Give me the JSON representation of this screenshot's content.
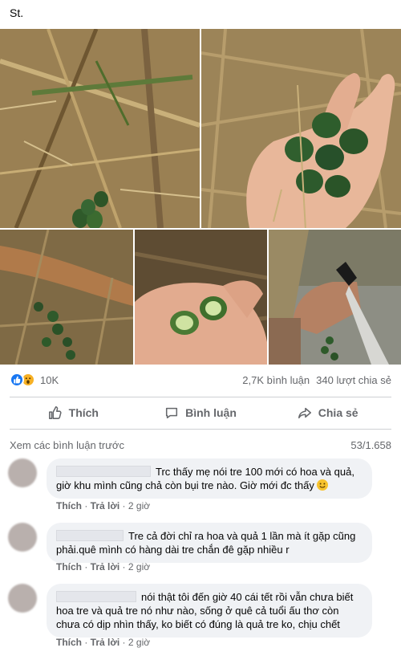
{
  "post": {
    "text": "St."
  },
  "photos": [
    {
      "icon": "bamboo-branch-photo"
    },
    {
      "icon": "hand-holding-bamboo-fruit-photo"
    },
    {
      "icon": "bamboo-stem-fruit-photo"
    },
    {
      "icon": "cut-fruit-in-hand-photo"
    },
    {
      "icon": "hand-with-knife-photo"
    }
  ],
  "stats": {
    "reaction_count": "10K",
    "comments": "2,7K bình luận",
    "shares": "340 lượt chia sẻ"
  },
  "actions": {
    "like": "Thích",
    "comment": "Bình luận",
    "share": "Chia sẻ"
  },
  "comments_header": {
    "view_previous": "Xem các bình luận trước",
    "count": "53/1.658"
  },
  "comments": [
    {
      "text": "Trc thấy mẹ nói tre 100 mới có hoa và quả, giờ khu mình cũng chả còn bụi tre nào. Giờ mới đc thấy",
      "like": "Thích",
      "reply": "Trả lời",
      "time": "2 giờ"
    },
    {
      "text": "Tre cả đời chỉ ra hoa và quả 1 lần mà ít gặp cũng phải.quê mình có hàng dài tre chắn đê gặp nhiều r",
      "like": "Thích",
      "reply": "Trả lời",
      "time": "2 giờ"
    },
    {
      "text": "nói thật tôi đến giờ 40 cái tết rồi vẫn chưa biết hoa tre và quả tre nó như nào, sống ở quê cả tuổi ấu thơ còn chưa có dịp nhìn thấy, ko biết có đúng là quả tre ko, chịu chết",
      "like": "Thích",
      "reply": "Trả lời",
      "time": "2 giờ"
    }
  ],
  "colors": {
    "like_blue": "#1877f2",
    "wow_yellow": "#f7b125",
    "bubble_bg": "#f0f2f5",
    "muted_text": "#65676b"
  }
}
